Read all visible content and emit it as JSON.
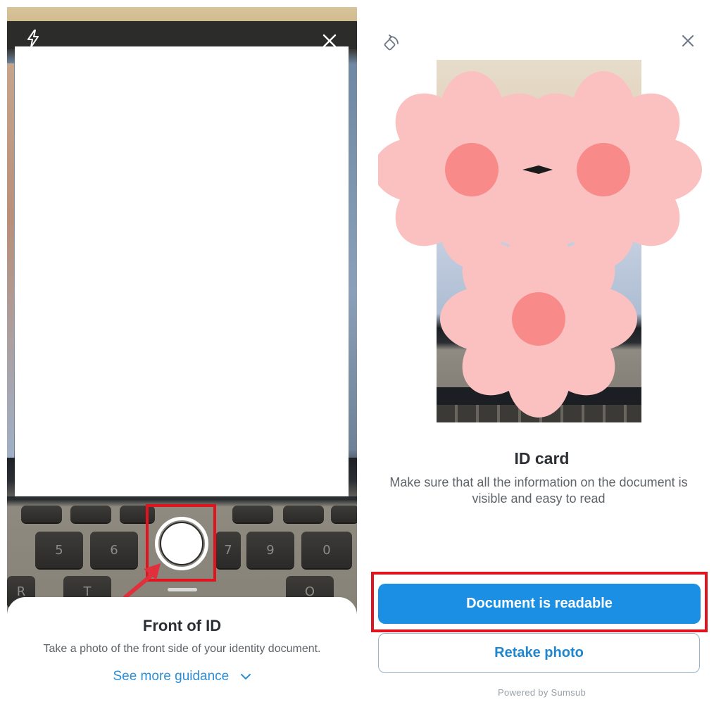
{
  "left_screen": {
    "icons": {
      "flash": "flash-icon",
      "close": "close-icon"
    },
    "key_labels": [
      "5",
      "6",
      "7",
      "9",
      "0",
      "R",
      "T",
      "O"
    ],
    "sheet": {
      "title": "Front of ID",
      "subtitle": "Take a photo of the front side of your identity document.",
      "guidance_link": "See more guidance",
      "guidance_icon": "chevron-down-icon"
    },
    "highlight_color": "#e0141e"
  },
  "right_screen": {
    "icons": {
      "rotate": "rotate-icon",
      "close": "close-icon"
    },
    "title": "ID card",
    "description": "Make sure that all the information on the document is visible and easy to read",
    "primary_button": "Document is readable",
    "secondary_button": "Retake photo",
    "footer": "Powered by Sumsub",
    "accent_color": "#1a8fe3",
    "highlight_color": "#e0141e"
  }
}
